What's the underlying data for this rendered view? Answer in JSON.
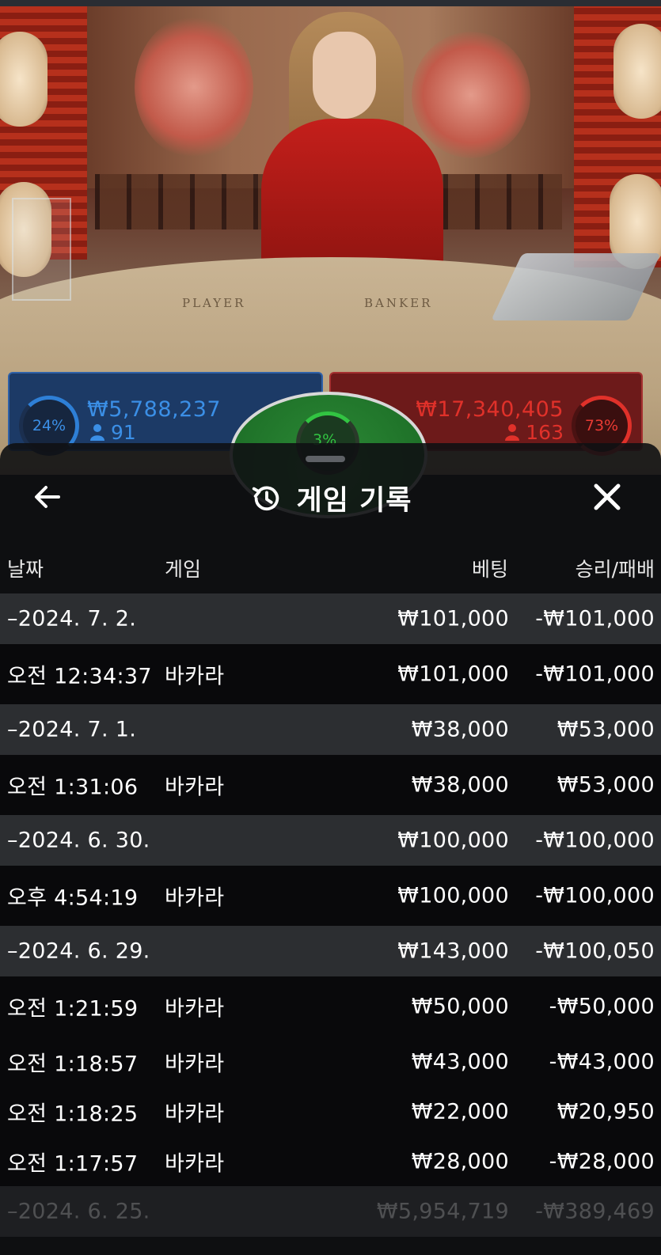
{
  "stage": {
    "table_player_word": "PLAYER",
    "table_banker_word": "BANKER"
  },
  "bets": {
    "player": {
      "percent": "24%",
      "amount": "₩5,788,237",
      "count": "91",
      "color": "#3b8fe6"
    },
    "banker": {
      "percent": "73%",
      "amount": "₩17,340,405",
      "count": "163",
      "color": "#e0312a"
    },
    "tie": {
      "percent": "3%",
      "color": "#32c442"
    }
  },
  "sheet": {
    "title": "게임 기록",
    "icons": {
      "back": "arrow-left-icon",
      "history": "history-icon",
      "close": "close-icon",
      "user": "user-icon"
    },
    "columns": {
      "date": "날짜",
      "game": "게임",
      "bet": "베팅",
      "result": "승리/패배"
    },
    "rows": [
      {
        "type": "group",
        "date": "–2024. 7. 2.",
        "game": "",
        "bet": "₩101,000",
        "result": "-₩101,000"
      },
      {
        "type": "detail",
        "date": "오전 12:34:37",
        "game": "바카라",
        "bet": "₩101,000",
        "result": "-₩101,000"
      },
      {
        "type": "group",
        "date": "–2024. 7. 1.",
        "game": "",
        "bet": "₩38,000",
        "result": "₩53,000"
      },
      {
        "type": "detail",
        "date": "오전 1:31:06",
        "game": "바카라",
        "bet": "₩38,000",
        "result": "₩53,000"
      },
      {
        "type": "group",
        "date": "–2024. 6. 30.",
        "game": "",
        "bet": "₩100,000",
        "result": "-₩100,000"
      },
      {
        "type": "detail",
        "date": "오후 4:54:19",
        "game": "바카라",
        "bet": "₩100,000",
        "result": "-₩100,000"
      },
      {
        "type": "group",
        "date": "–2024. 6. 29.",
        "game": "",
        "bet": "₩143,000",
        "result": "-₩100,050"
      },
      {
        "type": "detail",
        "date": "오전 1:21:59",
        "game": "바카라",
        "bet": "₩50,000",
        "result": "-₩50,000"
      },
      {
        "type": "compact",
        "date": "오전 1:18:57",
        "game": "바카라",
        "bet": "₩43,000",
        "result": "-₩43,000"
      },
      {
        "type": "compact",
        "date": "오전 1:18:25",
        "game": "바카라",
        "bet": "₩22,000",
        "result": "₩20,950"
      },
      {
        "type": "compact",
        "date": "오전 1:17:57",
        "game": "바카라",
        "bet": "₩28,000",
        "result": "-₩28,000"
      },
      {
        "type": "fade",
        "date": "–2024. 6. 25.",
        "game": "",
        "bet": "₩5,954,719",
        "result": "-₩389,469"
      }
    ]
  }
}
